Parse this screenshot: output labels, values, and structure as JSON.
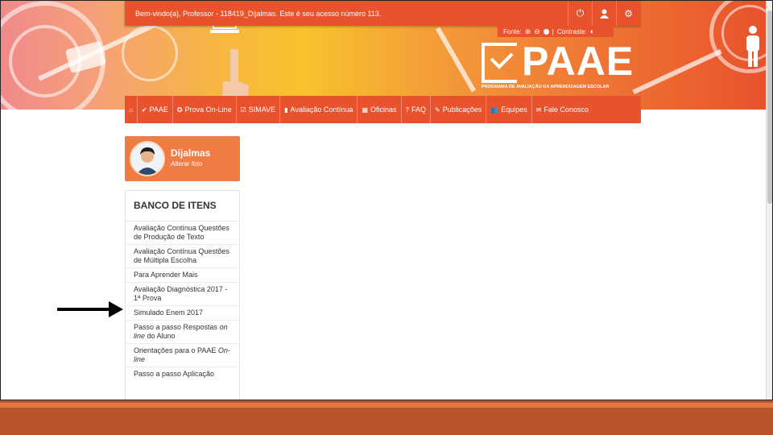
{
  "topbar": {
    "welcome": "Bem-vindo(a), Professor - 118419_Dijalmas. Este é seu acesso número 113.",
    "icons": [
      "power-icon",
      "user-icon",
      "gear-icon"
    ]
  },
  "accessibility": {
    "font_label": "Fonte:",
    "contrast_label": "Contraste:"
  },
  "logo": {
    "word": "PAAE",
    "subtitle": "PROGRAMA DE AVALIAÇÃO DA APRENDIZAGEM ESCOLAR"
  },
  "nav": [
    {
      "icon": "home-icon",
      "label": ""
    },
    {
      "icon": "check-icon",
      "label": "PAAE"
    },
    {
      "icon": "check-circle-icon",
      "label": "Prova On-Line"
    },
    {
      "icon": "check-square-icon",
      "label": "SIMAVE"
    },
    {
      "icon": "file-icon",
      "label": "Avaliação Contínua"
    },
    {
      "icon": "calendar-icon",
      "label": "Oficinas"
    },
    {
      "icon": "question-icon",
      "label": "FAQ"
    },
    {
      "icon": "pencil-icon",
      "label": "Publicações"
    },
    {
      "icon": "users-icon",
      "label": "Equipes"
    },
    {
      "icon": "envelope-icon",
      "label": "Fale Conosco"
    }
  ],
  "profile": {
    "name": "Dijalmas",
    "edit_photo": "Alterar foto"
  },
  "menu": {
    "title": "BANCO DE ITENS",
    "items": [
      {
        "label": "Avaliação Contínua Questões de Produção de Texto"
      },
      {
        "label": "Avaliação Contínua Questões de Múltipla Escolha"
      },
      {
        "label": "Para Aprender Mais"
      },
      {
        "label": "Avaliação Diagnóstica 2017 - 1ª Prova"
      },
      {
        "label": "Simulado Enem 2017"
      },
      {
        "label_a": "Passo a passo Respostas ",
        "label_i": "on line",
        "label_b": " do Aluno"
      },
      {
        "label_a": "Orientações para o PAAE ",
        "label_i": "On-line",
        "label_b": ""
      },
      {
        "label": "Passo a passo Aplicação"
      }
    ]
  },
  "colors": {
    "brand_orange": "#e8522c",
    "profile_orange": "#ef7d43",
    "footer_band": "#b9542d"
  }
}
